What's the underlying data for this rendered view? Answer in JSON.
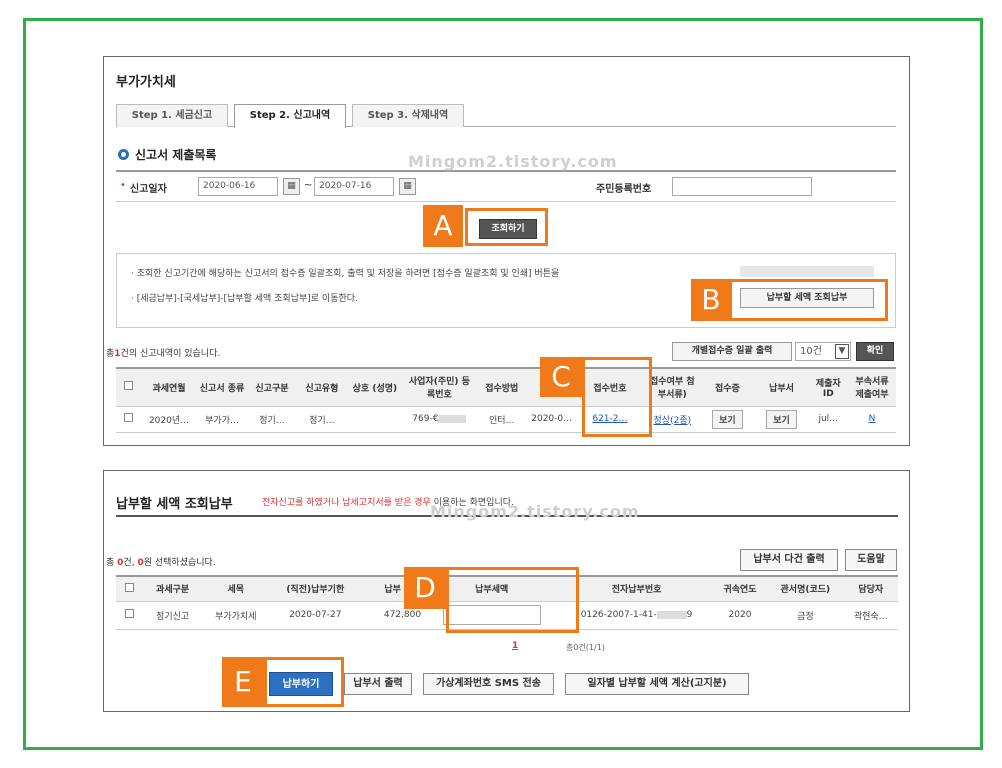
{
  "watermark": "Mingom2.tistory.com",
  "panel1": {
    "title": "부가가치세",
    "tabs": [
      "Step 1. 세금신고",
      "Step 2. 신고내역",
      "Step 3. 삭제내역"
    ],
    "section_title": "신고서 제출목록",
    "search": {
      "date_label": "신고일자",
      "required_mark": "•",
      "date_from": "2020-06-16",
      "tilde": "~",
      "date_to": "2020-07-16",
      "resident_label": "주민등록번호",
      "resident_value": ""
    },
    "query_button": "조회하기",
    "info_line1": "· 조회한 신고기간에 해당하는 신고서의 접수증 일괄조회, 출력 및 저장을 하려면 [접수증 일괄조회 및 인쇄] 버튼을",
    "info_line2": "· [세금납부]-[국세납부]-[납부할 세액 조회납부]로 이동한다.",
    "pay_inquiry_button": "납부할 세액 조회납부",
    "count_prefix": "총",
    "count_value": "1",
    "count_suffix": "건의 신고내역이 있습니다.",
    "bulk_print_button": "개별접수증 일괄 출력",
    "page_size": "10건",
    "confirm_button": "확인",
    "headers": [
      "",
      "과세연월",
      "신고서 종류",
      "신고구분",
      "신고유형",
      "상호 (성명)",
      "사업자(주민) 등록번호",
      "접수방법",
      "",
      "접수번호",
      "접수여부 첨부서류)",
      "접수증",
      "납부서",
      "제출자 ID",
      "부속서류 제출여부"
    ],
    "row": [
      "",
      "2020년…",
      "부가가…",
      "정기…",
      "정기…",
      "",
      "769-€",
      "인터…",
      "2020-0…",
      "621-2…",
      "정상(2종)",
      "보기",
      "보기",
      "jul…",
      "N"
    ]
  },
  "panel2": {
    "title": "납부할 세액 조회납부",
    "subtitle_red": "전자신고를 하였거나 납세고지서를 받은 경우",
    "subtitle_rest": "이용하는 화면입니다.",
    "selected_prefix": "총",
    "selected_count": "0",
    "selected_mid": "건,",
    "selected_amount": "0",
    "selected_suffix": "원 선택하셨습니다.",
    "multi_print_button": "납부서 다건 출력",
    "help_button": "도움말",
    "headers": [
      "",
      "과세구분",
      "세목",
      "(직전)납부기한",
      "납부",
      "납부세액",
      "전자납부번호",
      "귀속연도",
      "관서명(코드)",
      "담당자"
    ],
    "row": [
      "",
      "정기신고",
      "부가가치세",
      "2020-07-27",
      "472,800",
      "",
      "0126-2007-1-41-",
      "2020",
      "금정",
      "곽현숙…"
    ],
    "row_epay_tail": "9",
    "page_current": "1",
    "page_total": "총0건(1/1)",
    "buttons": [
      "납부하기",
      "납부서 출력",
      "가상계좌번호 SMS 전송",
      "일자별 납부할 세액 계산(고지분)"
    ]
  },
  "markers": [
    "A",
    "B",
    "C",
    "D",
    "E"
  ],
  "colors": {
    "frame": "#2fae4a",
    "marker": "#f07a1a",
    "pay_button": "#2d6fc1"
  }
}
